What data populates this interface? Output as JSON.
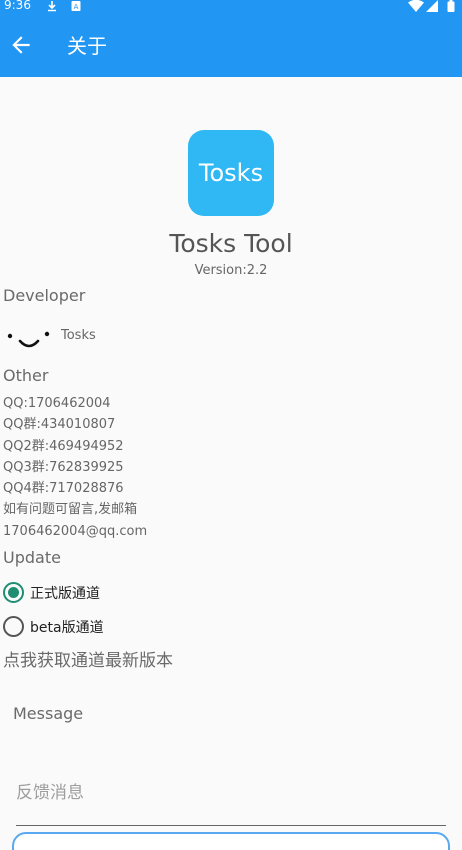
{
  "status_bar": {
    "time": "9:36",
    "icons": [
      "download-icon",
      "notification-icon",
      "wifi-icon",
      "signal-icon",
      "battery-icon"
    ]
  },
  "app_bar": {
    "title": "关于",
    "back_icon": "arrow-left-icon",
    "color": "#2196f3"
  },
  "app": {
    "logo_text": "Tosks",
    "logo_color": "#2fb8f3",
    "name": "Tosks Tool",
    "version": "Version:2.2"
  },
  "developer": {
    "heading": "Developer",
    "name": "Tosks",
    "avatar_icon": "smiley-face-icon"
  },
  "other": {
    "heading": "Other",
    "lines": [
      "QQ:1706462004",
      "QQ群:434010807",
      "QQ2群:469494952",
      "QQ3群:762839925",
      "QQ4群:717028876",
      "如有问题可留言,发邮箱",
      "1706462004@qq.com"
    ]
  },
  "update": {
    "heading": "Update",
    "options": [
      {
        "label": "正式版通道",
        "selected": true
      },
      {
        "label": "beta版通道",
        "selected": false
      }
    ],
    "fetch_label": "点我获取通道最新版本",
    "accent": "#1e8e73"
  },
  "message": {
    "label": "Message",
    "placeholder": "反馈消息"
  }
}
